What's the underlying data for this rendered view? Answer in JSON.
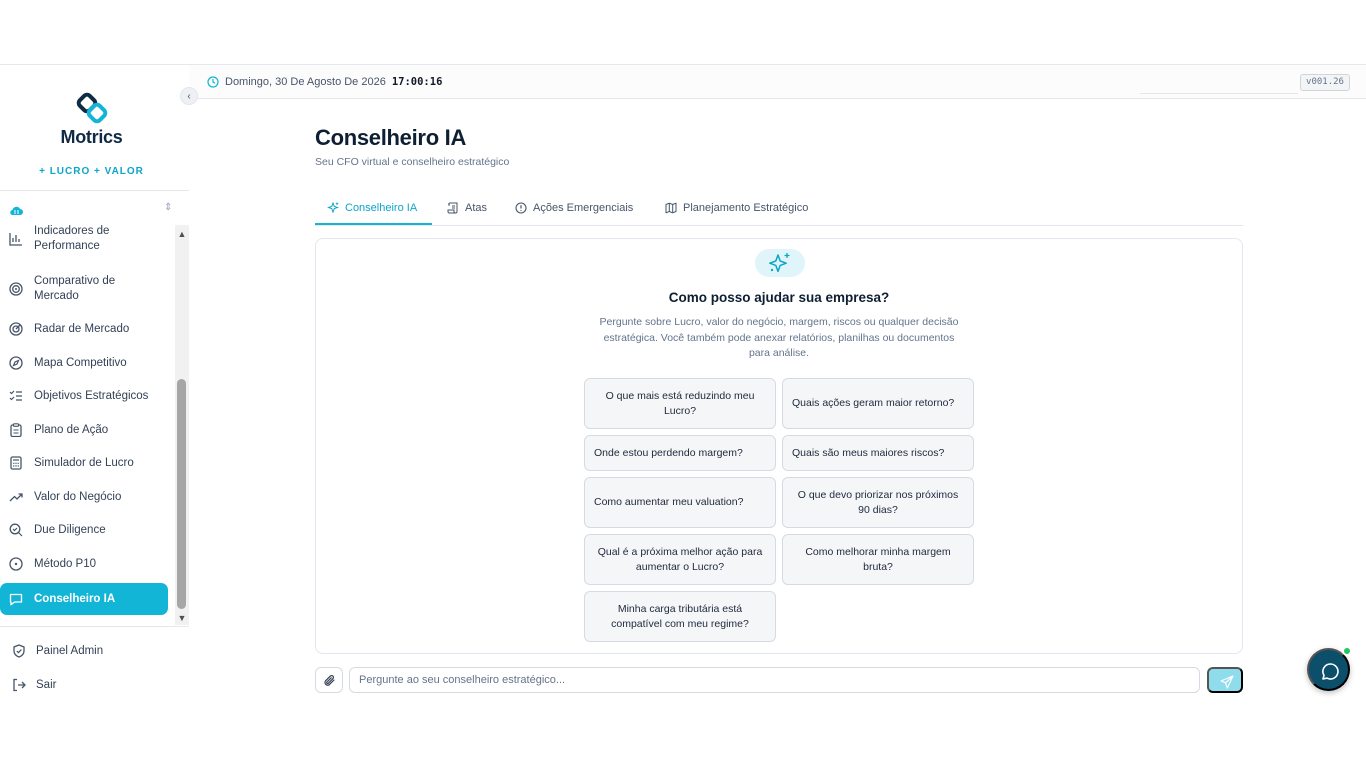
{
  "brand": {
    "name": "Motrics",
    "tagline": "+ LUCRO + VALOR"
  },
  "topbar": {
    "date": "Domingo, 30 De Agosto De 2026",
    "time": "17:00:16",
    "version": "v001.26"
  },
  "sidebar": {
    "items": [
      {
        "label": "Indicadores de Performance",
        "icon": "bar-chart-icon"
      },
      {
        "label": "Comparativo de Mercado",
        "icon": "target-icon"
      },
      {
        "label": "Radar de Mercado",
        "icon": "radar-icon"
      },
      {
        "label": "Mapa Competitivo",
        "icon": "compass-icon"
      },
      {
        "label": "Objetivos Estratégicos",
        "icon": "list-checks-icon"
      },
      {
        "label": "Plano de Ação",
        "icon": "clipboard-icon"
      },
      {
        "label": "Simulador de Lucro",
        "icon": "calculator-icon"
      },
      {
        "label": "Valor do Negócio",
        "icon": "trending-up-icon"
      },
      {
        "label": "Due Diligence",
        "icon": "search-check-icon"
      },
      {
        "label": "Método P10",
        "icon": "circle-dot-icon"
      },
      {
        "label": "Conselheiro IA",
        "icon": "message-icon",
        "active": true
      }
    ],
    "admin_label": "Painel Admin",
    "logout_label": "Sair"
  },
  "page": {
    "title": "Conselheiro IA",
    "subtitle": "Seu CFO virtual e conselheiro estratégico"
  },
  "tabs": [
    {
      "label": "Conselheiro IA",
      "icon": "sparkles-icon",
      "active": true
    },
    {
      "label": "Atas",
      "icon": "scroll-icon"
    },
    {
      "label": "Ações Emergenciais",
      "icon": "alert-circle-icon"
    },
    {
      "label": "Planejamento Estratégico",
      "icon": "map-icon"
    }
  ],
  "welcome": {
    "title": "Como posso ajudar sua empresa?",
    "description": "Pergunte sobre Lucro, valor do negócio, margem, riscos ou qualquer decisão estratégica. Você também pode anexar relatórios, planilhas ou documentos para análise."
  },
  "suggestions": [
    "O que mais está reduzindo meu Lucro?",
    "Quais ações geram maior retorno?",
    "Onde estou perdendo margem?",
    "Quais são meus maiores riscos?",
    "Como aumentar meu valuation?",
    "O que devo priorizar nos próximos 90 dias?",
    "Qual é a próxima melhor ação para aumentar o Lucro?",
    "Como melhorar minha margem bruta?",
    "Minha carga tributária está compatível com meu regime?"
  ],
  "composer": {
    "placeholder": "Pergunte ao seu conselheiro estratégico..."
  },
  "colors": {
    "accent": "#12b5d6",
    "brand_dark": "#0f2a44",
    "fab": "#0b4f6a",
    "online": "#22c55e"
  }
}
